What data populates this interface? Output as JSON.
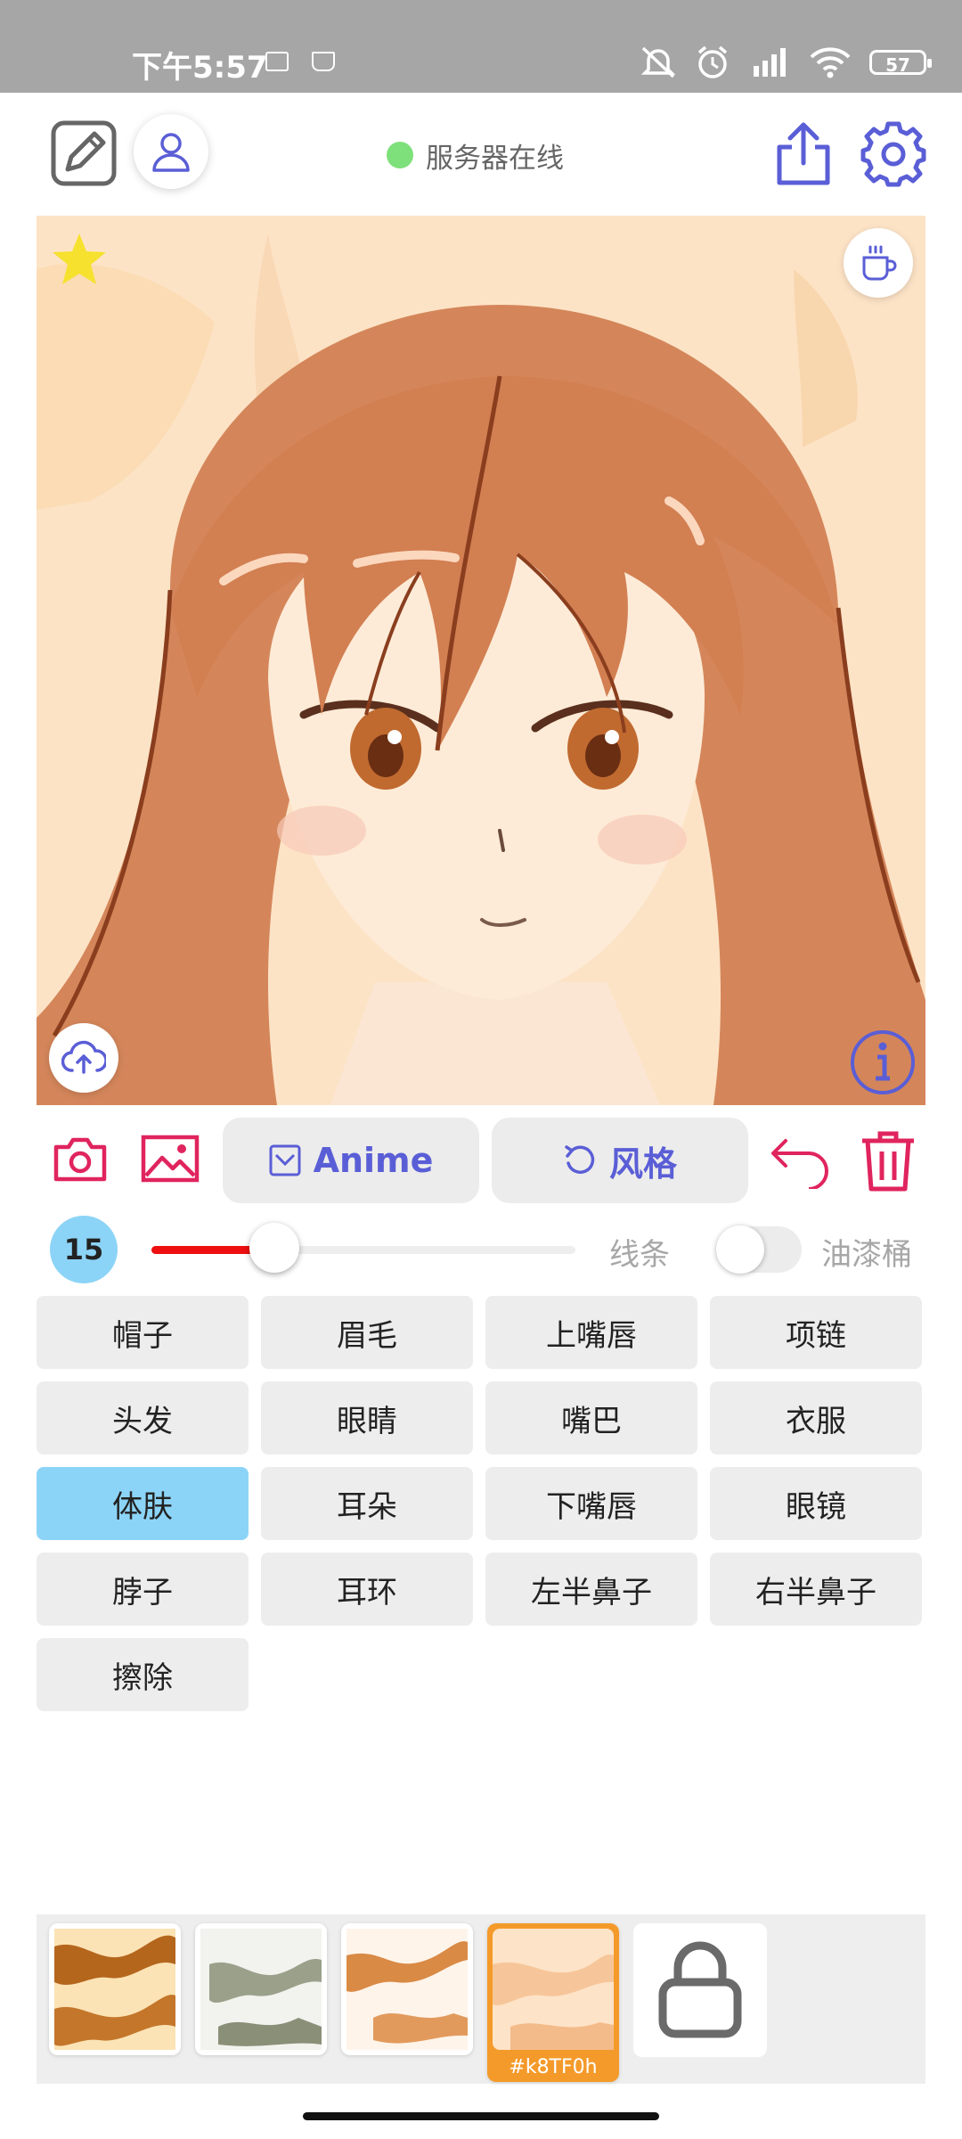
{
  "status_bar": {
    "time": "下午5:57",
    "battery": "57"
  },
  "header": {
    "server_status": "服务器在线",
    "server_status_color": "#7ee07a"
  },
  "toolbar": {
    "anime_label": "Anime",
    "style_label": "风格",
    "accent_color": "#5a5ed6",
    "danger_color": "#e0245e"
  },
  "brush": {
    "size": "15",
    "slider_fraction": 0.29,
    "line_label": "线条",
    "bucket_label": "油漆桶",
    "bucket_enabled": false
  },
  "parts": [
    {
      "label": "帽子",
      "active": false
    },
    {
      "label": "眉毛",
      "active": false
    },
    {
      "label": "上嘴唇",
      "active": false
    },
    {
      "label": "项链",
      "active": false
    },
    {
      "label": "头发",
      "active": false
    },
    {
      "label": "眼睛",
      "active": false
    },
    {
      "label": "嘴巴",
      "active": false
    },
    {
      "label": "衣服",
      "active": false
    },
    {
      "label": "体肤",
      "active": true
    },
    {
      "label": "耳朵",
      "active": false
    },
    {
      "label": "下嘴唇",
      "active": false
    },
    {
      "label": "眼镜",
      "active": false
    },
    {
      "label": "脖子",
      "active": false
    },
    {
      "label": "耳环",
      "active": false
    },
    {
      "label": "左半鼻子",
      "active": false
    },
    {
      "label": "右半鼻子",
      "active": false
    },
    {
      "label": "擦除",
      "active": false
    }
  ],
  "palette": {
    "selected_code": "#k8TF0h",
    "swatches": [
      {
        "colors": [
          "#b5661d",
          "#fbe3b5"
        ]
      },
      {
        "colors": [
          "#8a8f78",
          "#f2f2ee"
        ]
      },
      {
        "colors": [
          "#d98a45",
          "#fff4ea"
        ]
      },
      {
        "colors": [
          "#f6c69a",
          "#fde3c8"
        ]
      }
    ]
  },
  "icons": [
    "edit-icon",
    "user-icon",
    "share-icon",
    "gear-icon",
    "star-icon",
    "coffee-icon",
    "upload-icon",
    "info-icon",
    "camera-icon",
    "image-icon",
    "mail-icon",
    "refresh-icon",
    "undo-icon",
    "trash-icon",
    "lock-icon"
  ]
}
